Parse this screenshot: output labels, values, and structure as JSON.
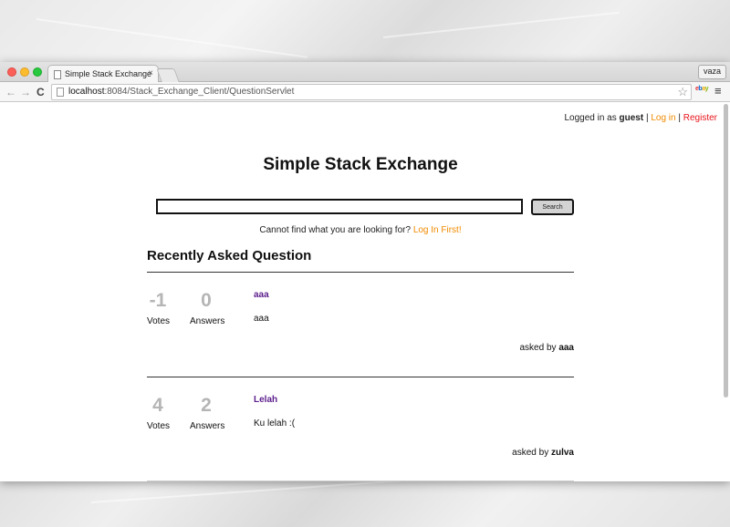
{
  "browser": {
    "tab_title": "Simple Stack Exchange",
    "tab_close": "×",
    "profile_name": "vaza",
    "url_host": "localhost",
    "url_rest": ":8084/Stack_Exchange_Client/QuestionServlet",
    "back_glyph": "←",
    "forward_glyph": "→",
    "reload_glyph": "C",
    "star_glyph": "☆",
    "menu_glyph": "≡",
    "extension_icon": "ebay-icon",
    "extension_letters": [
      "e",
      "b",
      "a",
      "y"
    ]
  },
  "auth": {
    "prefix": "Logged in as ",
    "user": "guest",
    "separator": " | ",
    "login_label": "Log in",
    "register_label": "Register"
  },
  "site": {
    "title": "Simple Stack Exchange"
  },
  "search": {
    "value": "",
    "button_label": "Search",
    "hint_text": "Cannot find what you are looking for? ",
    "hint_link": "Log In First!"
  },
  "section_title": "Recently Asked Question",
  "questions": [
    {
      "votes": "-1",
      "votes_label": "Votes",
      "answers": "0",
      "answers_label": "Answers",
      "title": "aaa",
      "body": "aaa",
      "asked_by_label": "asked by ",
      "author": "aaa"
    },
    {
      "votes": "4",
      "votes_label": "Votes",
      "answers": "2",
      "answers_label": "Answers",
      "title": "Lelah",
      "body": "Ku lelah :(",
      "asked_by_label": "asked by ",
      "author": "zulva"
    }
  ],
  "colors": {
    "link_orange": "#f08a00",
    "link_red": "#e8151b",
    "question_title": "#5b1d8c",
    "stat_gray": "#b5b5b5"
  }
}
